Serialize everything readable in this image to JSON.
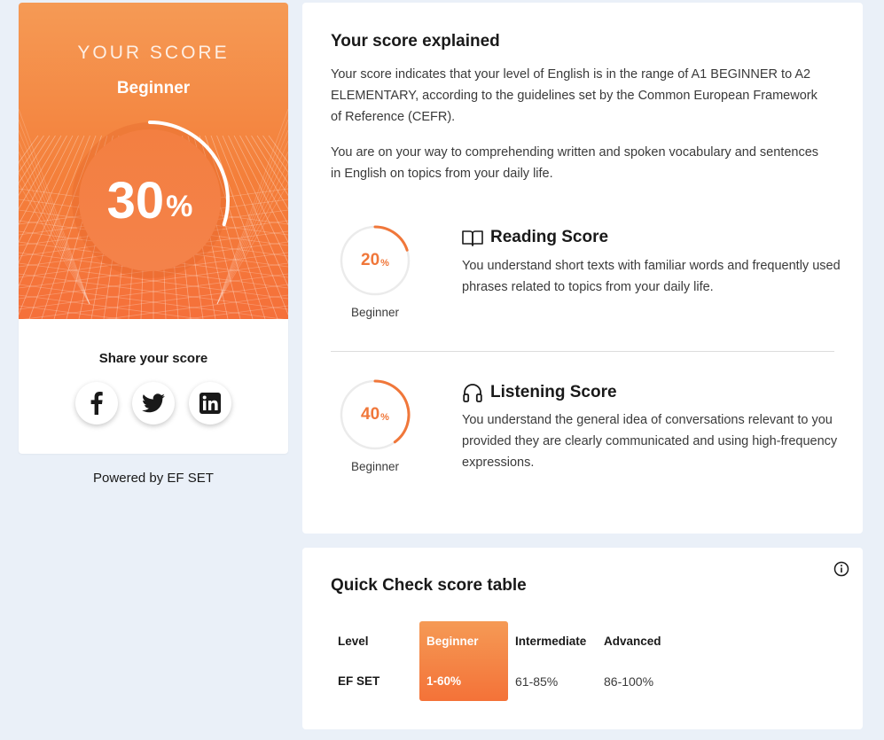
{
  "score_card": {
    "label": "YOUR SCORE",
    "level": "Beginner",
    "value": "30",
    "percent_sign": "%",
    "progress": 0.3,
    "share_label": "Share your score",
    "share_buttons": [
      "facebook-icon",
      "twitter-icon",
      "linkedin-icon"
    ],
    "brand_color": "#f47f3a"
  },
  "powered_by": "Powered by EF SET",
  "explained": {
    "title": "Your score explained",
    "paragraph1": "Your score indicates that your level of English is in the range of A1 BEGINNER to A2 ELEMENTARY, according to the guidelines set by the Common European Framework of Reference (CEFR).",
    "paragraph2": "You are on your way to comprehending written and spoken vocabulary and sentences in English on topics from your daily life.",
    "reading": {
      "icon": "book-icon",
      "title": "Reading Score",
      "value": "20",
      "percent_sign": "%",
      "progress": 0.2,
      "level": "Beginner",
      "description": "You understand short texts with familiar words and frequently used phrases related to topics from your daily life."
    },
    "listening": {
      "icon": "headphones-icon",
      "title": "Listening Score",
      "value": "40",
      "percent_sign": "%",
      "progress": 0.4,
      "level": "Beginner",
      "description": "You understand the general idea of conversations relevant to you provided they are clearly communicated and using high-frequency expressions."
    }
  },
  "score_table": {
    "title": "Quick Check score table",
    "info_icon": "info-icon",
    "row_headers": [
      "Level",
      "EF SET"
    ],
    "columns": [
      {
        "level": "Beginner",
        "range": "1-60%",
        "highlighted": true
      },
      {
        "level": "Intermediate",
        "range": "61-85%",
        "highlighted": false
      },
      {
        "level": "Advanced",
        "range": "86-100%",
        "highlighted": false
      }
    ]
  }
}
